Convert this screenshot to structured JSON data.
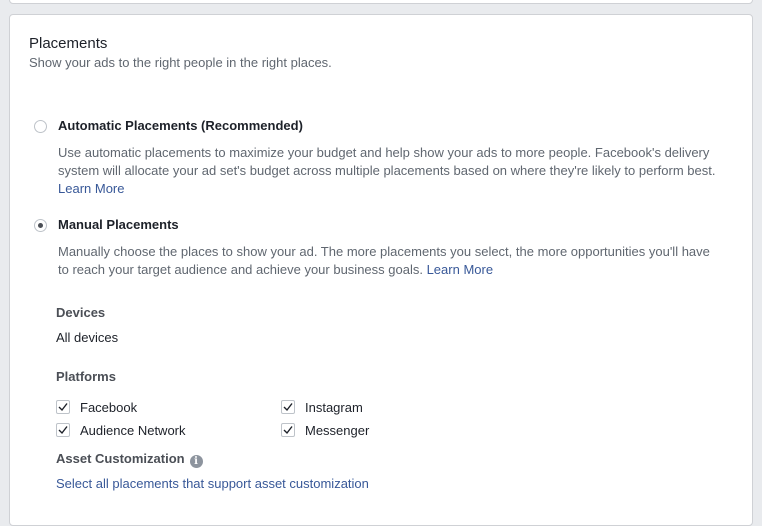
{
  "section": {
    "title": "Placements",
    "subtitle": "Show your ads to the right people in the right places."
  },
  "options": {
    "automatic": {
      "label": "Automatic Placements (Recommended)",
      "description": "Use automatic placements to maximize your budget and help show your ads to more people. Facebook's delivery system will allocate your ad set's budget across multiple placements based on where they're likely to perform best.",
      "link": "Learn More",
      "selected": false
    },
    "manual": {
      "label": "Manual Placements",
      "description": "Manually choose the places to show your ad. The more placements you select, the more opportunities you'll have to reach your target audience and achieve your business goals.",
      "link": "Learn More",
      "selected": true
    }
  },
  "devices": {
    "label": "Devices",
    "value": "All devices"
  },
  "platforms": {
    "label": "Platforms",
    "items": [
      {
        "label": "Facebook",
        "checked": true
      },
      {
        "label": "Instagram",
        "checked": true
      },
      {
        "label": "Audience Network",
        "checked": true
      },
      {
        "label": "Messenger",
        "checked": true
      }
    ]
  },
  "asset_customization": {
    "label": "Asset Customization",
    "info_icon": "info-icon",
    "link": "Select all placements that support asset customization"
  }
}
